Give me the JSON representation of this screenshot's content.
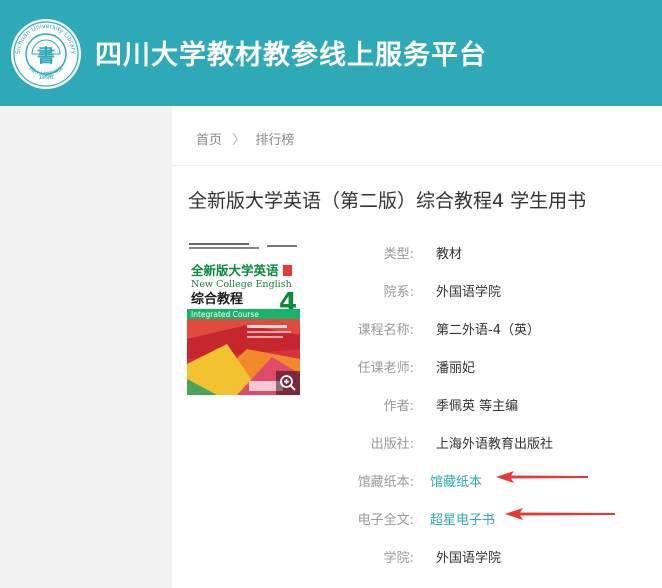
{
  "header": {
    "site_title": "四川大学教材教参线上服务平台",
    "logo_char": "書",
    "logo_ring_text": "Sichuan University Library",
    "logo_bottom_text": "四川大学图书馆",
    "logo_year": "1896"
  },
  "breadcrumb": {
    "home": "首页",
    "separator": "〉",
    "current": "排行榜"
  },
  "book": {
    "title": "全新版大学英语（第二版）综合教程4 学生用书",
    "cover": {
      "title_cn": "全新版大学英语",
      "title_en": "New College English",
      "subtitle_cn": "综合教程",
      "subtitle_en": "Integrated Course",
      "volume": "4"
    },
    "fields": [
      {
        "label": "类型:",
        "value": "教材"
      },
      {
        "label": "院系:",
        "value": "外国语学院"
      },
      {
        "label": "课程名称:",
        "value": "第二外语-4（英）"
      },
      {
        "label": "任课老师:",
        "value": "潘丽妃"
      },
      {
        "label": "作者:",
        "value": "季佩英 等主编"
      },
      {
        "label": "出版社:",
        "value": "上海外语教育出版社"
      }
    ],
    "links": [
      {
        "label": "馆藏纸本:",
        "value": "馆藏纸本"
      },
      {
        "label": "电子全文:",
        "value": "超星电子书"
      }
    ],
    "last_field": {
      "label": "学院:",
      "value": "外国语学院"
    }
  },
  "colors": {
    "header_bg": "#2ea9b8",
    "link": "#2ea9b8",
    "arrow": "#e53935"
  },
  "icons": {
    "zoom": "zoom-in-icon",
    "breadcrumb_separator": "chevron-right-icon",
    "annotation": "red-arrow"
  }
}
